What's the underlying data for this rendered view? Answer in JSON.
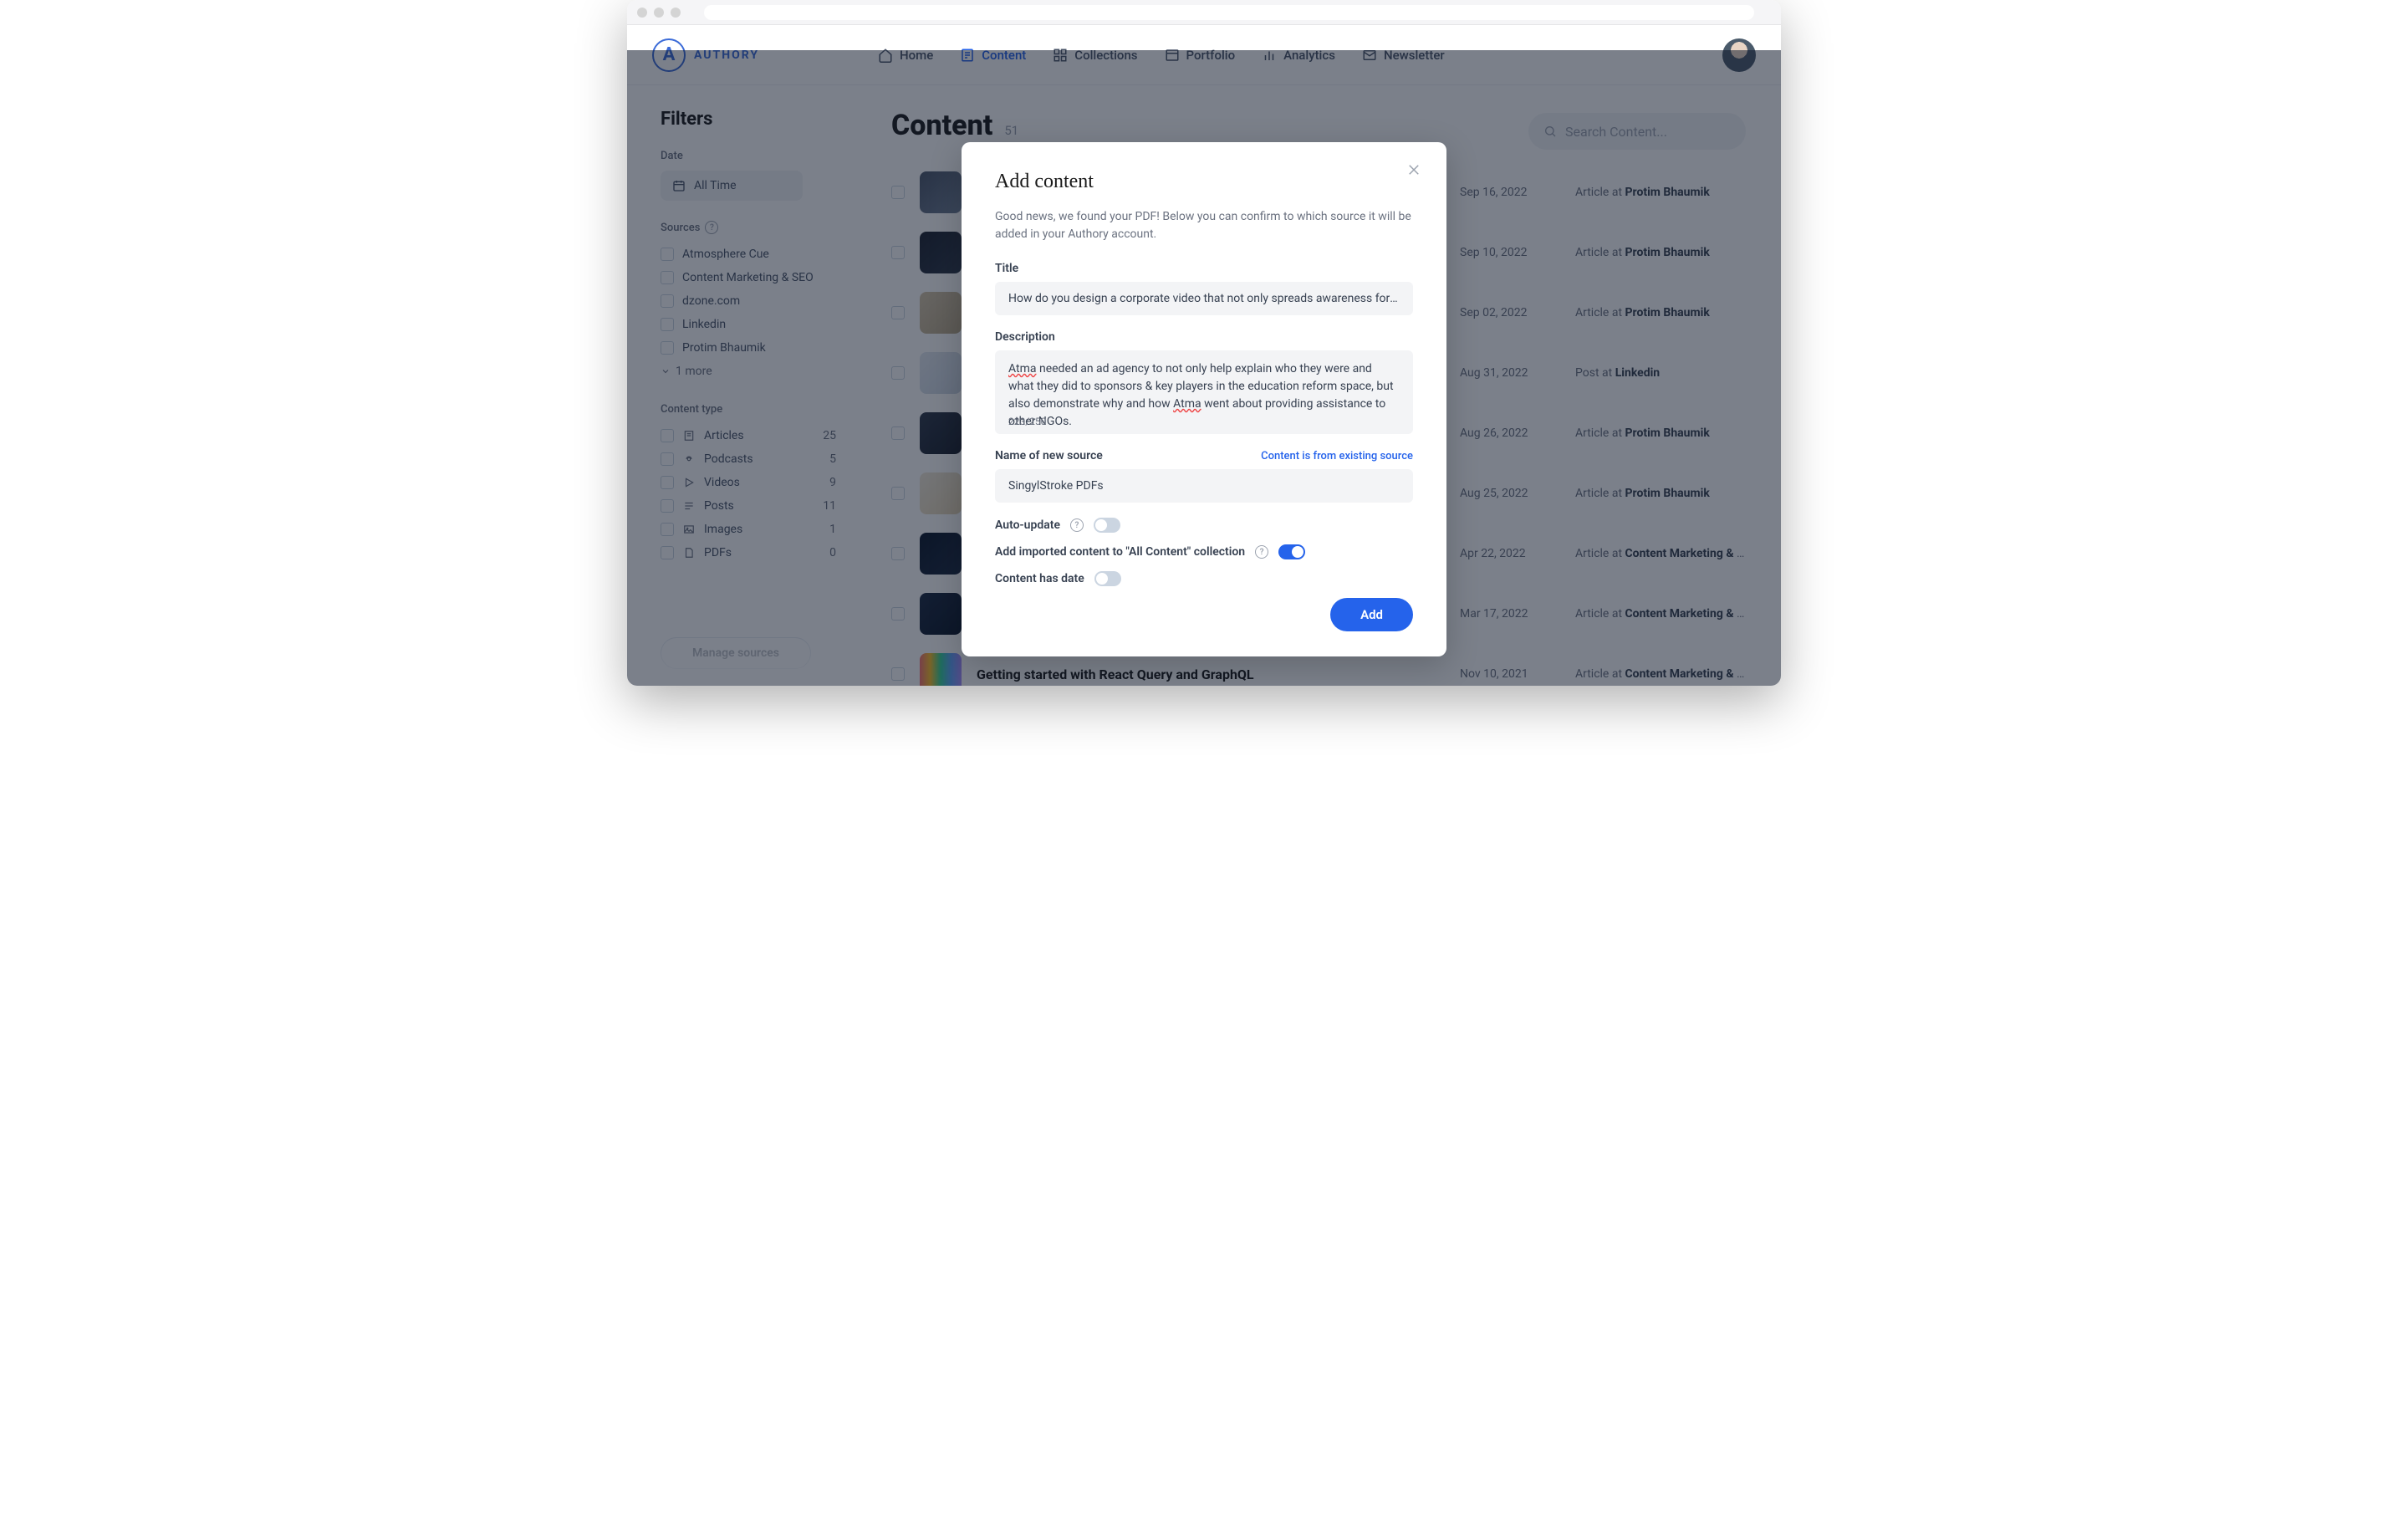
{
  "brand": {
    "name": "AUTHORY",
    "glyph": "A"
  },
  "nav": {
    "home": "Home",
    "content": "Content",
    "collections": "Collections",
    "portfolio": "Portfolio",
    "analytics": "Analytics",
    "newsletter": "Newsletter"
  },
  "sidebar": {
    "title": "Filters",
    "date_label": "Date",
    "date_value": "All Time",
    "sources_label": "Sources",
    "sources": [
      "Atmosphere Cue",
      "Content Marketing & SEO",
      "dzone.com",
      "Linkedin",
      "Protim Bhaumik"
    ],
    "more_label": "1 more",
    "types_label": "Content type",
    "types": [
      {
        "label": "Articles",
        "count": "25"
      },
      {
        "label": "Podcasts",
        "count": "5"
      },
      {
        "label": "Videos",
        "count": "9"
      },
      {
        "label": "Posts",
        "count": "11"
      },
      {
        "label": "Images",
        "count": "1"
      },
      {
        "label": "PDFs",
        "count": "0"
      }
    ],
    "manage_btn": "Manage sources"
  },
  "page": {
    "title": "Content",
    "count": "51",
    "search_placeholder": "Search Content..."
  },
  "rows": [
    {
      "date": "Sep 16, 2022",
      "meta_prefix": "Article at ",
      "meta_source": "Protim Bhaumik"
    },
    {
      "date": "Sep 10, 2022",
      "meta_prefix": "Article at ",
      "meta_source": "Protim Bhaumik"
    },
    {
      "date": "Sep 02, 2022",
      "meta_prefix": "Article at ",
      "meta_source": "Protim Bhaumik"
    },
    {
      "date": "Aug 31, 2022",
      "meta_prefix": "Post at ",
      "meta_source": "Linkedin"
    },
    {
      "date": "Aug 26, 2022",
      "meta_prefix": "Article at ",
      "meta_source": "Protim Bhaumik"
    },
    {
      "date": "Aug 25, 2022",
      "meta_prefix": "Article at ",
      "meta_source": "Protim Bhaumik"
    },
    {
      "date": "Apr 22, 2022",
      "meta_prefix": "Article at ",
      "meta_source": "Content Marketing & S..."
    },
    {
      "date": "Mar 17, 2022",
      "meta_prefix": "Article at ",
      "meta_source": "Content Marketing & S..."
    },
    {
      "title": "Getting started with React Query and GraphQL",
      "date": "Nov 10, 2021",
      "meta_prefix": "Article at ",
      "meta_source": "Content Marketing & S..."
    }
  ],
  "modal": {
    "title": "Add content",
    "intro": "Good news, we found your PDF! Below you can confirm to which source it will be added in your Authory account.",
    "title_label": "Title",
    "title_value": "How do you design a corporate video that not only spreads awareness for a socia",
    "desc_label": "Description",
    "desc_value_pre": " needed an ad agency to not only help explain who they were and what they did to sponsors & key players in the education reform space, but also demonstrate why and how ",
    "desc_value_post": " went about providing assistance to other NGOs.",
    "desc_atma": "Atma",
    "char_count": "223/250",
    "source_label": "Name of new source",
    "existing_link": "Content is from existing source",
    "source_value": "SingylStroke PDFs",
    "auto_update_label": "Auto-update",
    "all_content_label": "Add imported content to \"All Content\" collection",
    "has_date_label": "Content has date",
    "add_btn": "Add"
  }
}
